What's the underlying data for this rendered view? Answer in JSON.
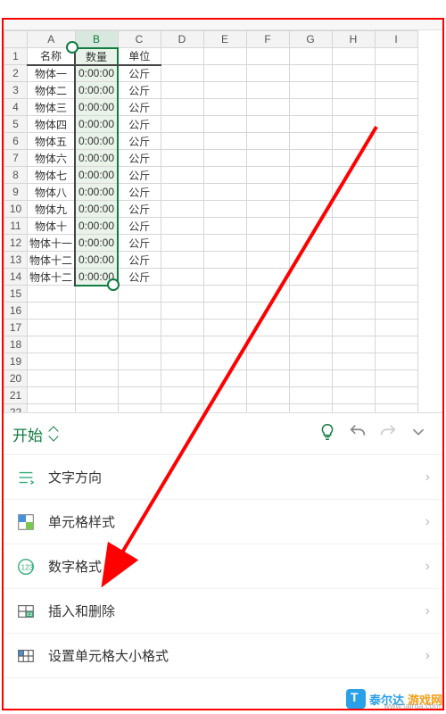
{
  "columns": [
    "A",
    "B",
    "C",
    "D",
    "E",
    "F",
    "G",
    "H",
    "I"
  ],
  "row_count": 26,
  "data": {
    "headers": {
      "A": "名称",
      "B": "数量",
      "C": "单位"
    },
    "rows": [
      {
        "A": "物体一",
        "B": "0:00:00",
        "C": "公斤"
      },
      {
        "A": "物体二",
        "B": "0:00:00",
        "C": "公斤"
      },
      {
        "A": "物体三",
        "B": "0:00:00",
        "C": "公斤"
      },
      {
        "A": "物体四",
        "B": "0:00:00",
        "C": "公斤"
      },
      {
        "A": "物体五",
        "B": "0:00:00",
        "C": "公斤"
      },
      {
        "A": "物体六",
        "B": "0:00:00",
        "C": "公斤"
      },
      {
        "A": "物体七",
        "B": "0:00:00",
        "C": "公斤"
      },
      {
        "A": "物体八",
        "B": "0:00:00",
        "C": "公斤"
      },
      {
        "A": "物体九",
        "B": "0:00:00",
        "C": "公斤"
      },
      {
        "A": "物体十",
        "B": "0:00:00",
        "C": "公斤"
      },
      {
        "A": "物体十一",
        "B": "0:00:00",
        "C": "公斤"
      },
      {
        "A": "物体十二",
        "B": "0:00:00",
        "C": "公斤"
      },
      {
        "A": "物体十二",
        "B": "0:00:00",
        "C": "公斤"
      }
    ]
  },
  "selection": {
    "col": "B",
    "row_start": 1,
    "row_end": 14
  },
  "toolbar": {
    "tab_label": "开始",
    "icons": {
      "bulb": "bulb-icon",
      "undo": "undo-icon",
      "redo": "redo-icon",
      "more": "more-icon"
    }
  },
  "menu": [
    {
      "id": "text-direction",
      "label": "文字方向",
      "icon": "text-direction-icon"
    },
    {
      "id": "cell-style",
      "label": "单元格样式",
      "icon": "cell-style-icon"
    },
    {
      "id": "number-format",
      "label": "数字格式",
      "icon": "number-format-icon"
    },
    {
      "id": "insert-delete",
      "label": "插入和删除",
      "icon": "insert-delete-icon"
    },
    {
      "id": "cell-size",
      "label": "设置单元格大小格式",
      "icon": "cell-size-icon"
    }
  ],
  "watermark": {
    "part1": "泰尔达",
    "part2": "游戏网",
    "url": "www.talrda.com"
  },
  "colors": {
    "accent": "#107c41",
    "annotation": "#ff0000"
  }
}
